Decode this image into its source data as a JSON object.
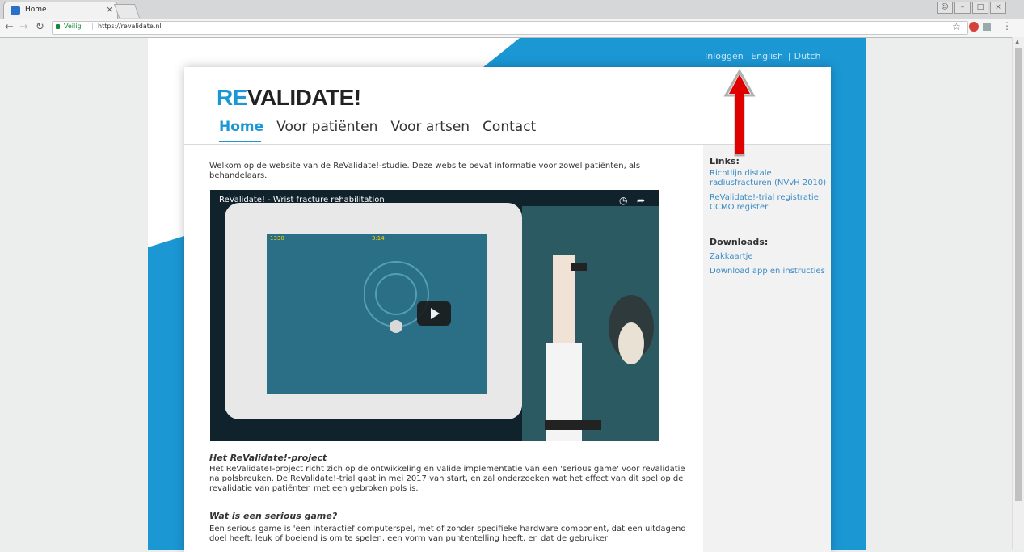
{
  "browser": {
    "tab_title": "Home",
    "tab_close": "×",
    "secure_label": "Veilig",
    "url_separator": "|",
    "url": "https://revalidate.nl"
  },
  "site": {
    "topbar": {
      "login": "Inloggen",
      "english": "English",
      "separator": "|",
      "dutch": "Dutch"
    },
    "logo": {
      "re": "RE",
      "rest": "VALIDATE!"
    },
    "nav": [
      "Home",
      "Voor patiënten",
      "Voor artsen",
      "Contact"
    ],
    "intro": "Welkom op de website van de ReValidate!-studie. Deze website bevat informatie voor zowel patiënten, als behandelaars.",
    "video": {
      "title": "ReValidate! - Wrist fracture rehabilitation",
      "score": "1330",
      "timer": "3:14"
    },
    "section1": {
      "title": "Het ReValidate!-project",
      "body": "Het ReValidate!-project richt zich op de ontwikkeling en valide implementatie van een 'serious game' voor revalidatie na polsbreuken. De ReValidate!-trial gaat in mei 2017 van start, en zal onderzoeken wat het effect van dit spel op de revalidatie van patiënten met een gebroken pols is."
    },
    "section2": {
      "title": "Wat is een serious game?",
      "body": "Een serious game is 'een interactief computerspel, met of zonder specifieke hardware component, dat een uitdagend doel heeft, leuk of boeiend is om te spelen, een vorm van puntentelling heeft, en dat de gebruiker"
    },
    "sidebar": {
      "links_title": "Links:",
      "links": [
        "Richtlijn distale radiusfracturen (NVvH 2010)",
        "ReValidate!-trial registratie: CCMO register"
      ],
      "downloads_title": "Downloads:",
      "downloads": [
        "Zakkaartje",
        "Download app en instructies"
      ]
    }
  },
  "colors": {
    "brand_blue": "#1b97d4",
    "link_blue": "#3b8cc5",
    "annotation_arrow": "#e00000"
  }
}
